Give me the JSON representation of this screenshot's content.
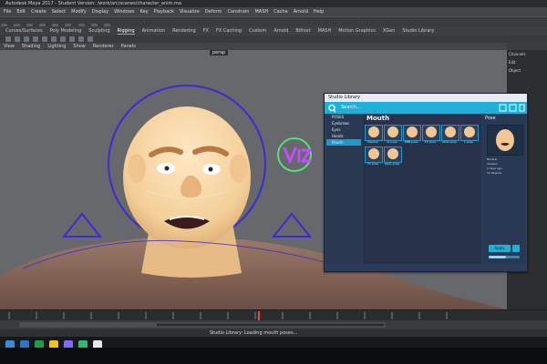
{
  "app": {
    "title": "Autodesk Maya 2017 - Student Version: /work/arc/scenes/character_anim.ma"
  },
  "menubar": {
    "items": [
      "File",
      "Edit",
      "Create",
      "Select",
      "Modify",
      "Display",
      "Windows",
      "Key",
      "Playback",
      "Visualize",
      "Deform",
      "Constrain",
      "MASH",
      "Cache",
      "Arnold",
      "Help"
    ]
  },
  "shelf": {
    "tabs": [
      "Curves/Surfaces",
      "Poly Modeling",
      "Sculpting",
      "Rigging",
      "Animation",
      "Rendering",
      "FX",
      "FX Caching",
      "Custom",
      "Arnold",
      "Bifrost",
      "MASH",
      "Motion Graphics",
      "XGen",
      "Studio Library"
    ],
    "active_tab": "Rigging"
  },
  "viewport": {
    "menu": [
      "View",
      "Shading",
      "Lighting",
      "Show",
      "Renderer",
      "Panels"
    ],
    "camera_label": "persp"
  },
  "right_dock": {
    "tabs": [
      "Channels",
      "Edit",
      "Object"
    ]
  },
  "statusbar": {
    "message": "Studio Library: Loading mouth poses..."
  },
  "pose_library": {
    "window_title": "Studio Library",
    "search_placeholder": "Search...",
    "folders": [
      {
        "label": "POSES",
        "active": false
      },
      {
        "label": "Eyebrows",
        "active": false
      },
      {
        "label": "Eyes",
        "active": false
      },
      {
        "label": "Hands",
        "active": false
      },
      {
        "label": "Mouth",
        "active": true
      }
    ],
    "section_title": "Mouth",
    "poses": [
      "Neutral",
      "AI pose",
      "EMB pose",
      "FV pose",
      "Wide pose",
      "L pose",
      "Th pose",
      "Open pose"
    ],
    "detail": {
      "header": "Pose",
      "info": {
        "name": "Neutral",
        "owner": "student",
        "date": "2 days ago",
        "objects": "12 Objects"
      },
      "apply_label": "Apply",
      "blend": 0.55
    }
  },
  "colors": {
    "accent": "#1fb0d8",
    "window_bg": "#2c3b58",
    "viewport_bg": "#66686b"
  }
}
